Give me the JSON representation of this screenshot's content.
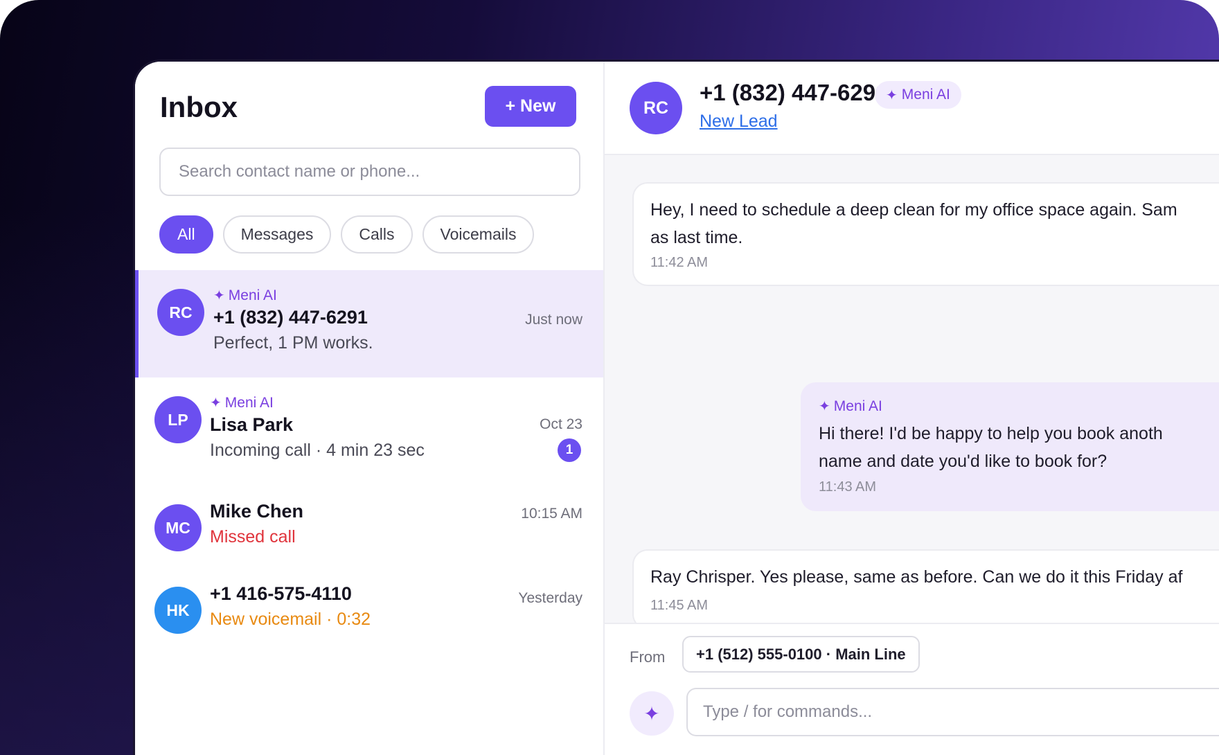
{
  "inbox": {
    "title": "Inbox",
    "new_label": "+ New",
    "search_placeholder": "Search contact name or phone...",
    "filters": [
      "All",
      "Messages",
      "Calls",
      "Voicemails"
    ],
    "active_filter": "All"
  },
  "conversations": [
    {
      "initials": "RC",
      "ai_label": "Meni AI",
      "name": "+1 (832) 447-6291",
      "preview": "Perfect, 1 PM works.",
      "time": "Just now",
      "selected": true
    },
    {
      "initials": "LP",
      "ai_label": "Meni AI",
      "name": "Lisa Park",
      "preview": "Incoming call · 4 min 23 sec",
      "time": "Oct 23",
      "unread": "1"
    },
    {
      "initials": "MC",
      "name": "Mike Chen",
      "preview": "Missed call",
      "time": "10:15 AM"
    },
    {
      "initials": "HK",
      "name": "+1 416-575-4110",
      "preview": "New voicemail · 0:32",
      "time": "Yesterday"
    }
  ],
  "chat": {
    "initials": "RC",
    "phone": "+1 (832) 447-6291",
    "ai_label": "Meni AI",
    "lead_label": "New Lead",
    "messages": [
      {
        "direction": "in",
        "lines": [
          "Hey, I need to schedule a deep clean for my office space again. Sam",
          "as last time."
        ],
        "time": "11:42 AM"
      },
      {
        "direction": "out",
        "ai_label": "Meni AI",
        "lines": [
          "Hi there! I'd be happy to help you book anoth",
          "name and date you'd like to book for?"
        ],
        "time": "11:43 AM"
      },
      {
        "direction": "in",
        "lines": [
          "Ray Chrisper. Yes please, same as before. Can we do it this Friday af"
        ],
        "time": "11:45 AM"
      }
    ]
  },
  "composer": {
    "from_label": "From",
    "from_value": "+1 (512) 555-0100 · Main Line",
    "placeholder": "Type / for commands..."
  },
  "colors": {
    "accent": "#6b4ff0",
    "ai_purple": "#7a3fe0",
    "missed_red": "#e0343c",
    "voicemail_orange": "#e88a12",
    "avatar_blue": "#2a8ff0"
  },
  "icons": {
    "ai": "sparkle-icon"
  }
}
